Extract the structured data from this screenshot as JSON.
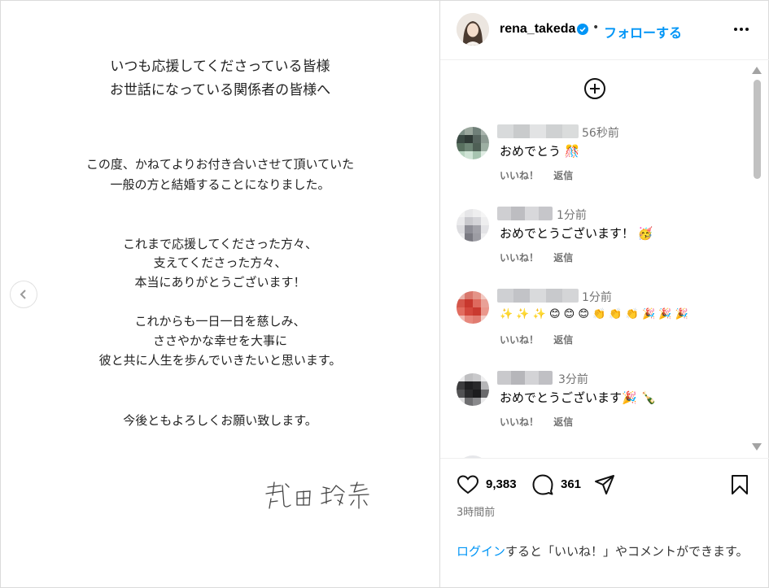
{
  "letter": {
    "greeting": [
      "いつも応援してくださっている皆様",
      "お世話になっている関係者の皆様へ"
    ],
    "para1": [
      "この度、かねてよりお付き合いさせて頂いていた",
      "一般の方と結婚することになりました。"
    ],
    "para2": [
      "これまで応援してくださった方々、",
      "支えてくださった方々、",
      "本当にありがとうございます！"
    ],
    "para3": [
      "これからも一日一日を慈しみ、",
      "ささやかな幸せを大事に",
      "彼と共に人生を歩んでいきたいと思います。"
    ],
    "closing": "今後ともよろしくお願い致します。",
    "signature": "武田 玲奈"
  },
  "header": {
    "username": "rena_takeda",
    "separator": "•",
    "follow_label": "フォローする"
  },
  "comments": [
    {
      "time": "56秒前",
      "text": "おめでとう 🎊",
      "like_label": "いいね！",
      "reply_label": "返信"
    },
    {
      "time": "1分前",
      "text": "おめでとうございます！ 🥳",
      "like_label": "いいね！",
      "reply_label": "返信"
    },
    {
      "time": "1分前",
      "text": "✨ ✨ ✨ 😊 😊 😊 👏 👏 👏 🎉 🎉 🎉",
      "like_label": "いいね！",
      "reply_label": "返信"
    },
    {
      "time": "3分前",
      "text": "おめでとうございます🎉 🍾",
      "like_label": "いいね！",
      "reply_label": "返信"
    }
  ],
  "stats": {
    "likes": "9,383",
    "comments": "361",
    "posted": "3時間前"
  },
  "login_prompt": {
    "link": "ログイン",
    "rest": "すると「いいね！」やコメントができます。"
  },
  "colors": {
    "accent": "#0095f6",
    "verified": "#0095f6",
    "muted": "#737373"
  }
}
